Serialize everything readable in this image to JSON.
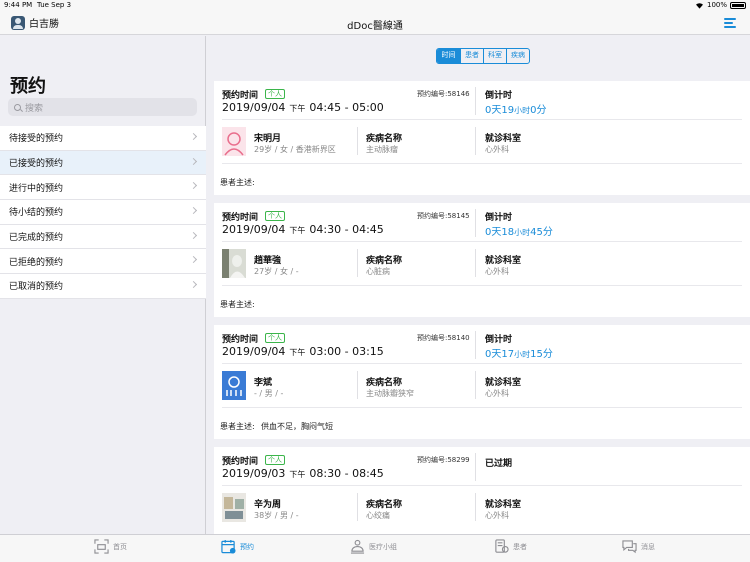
{
  "status": {
    "time": "9:44 PM",
    "date": "Tue Sep 3",
    "battery": "100%"
  },
  "nav": {
    "user_name": "白吉勝",
    "title": "dDoc醫線通"
  },
  "sidebar": {
    "title": "预约",
    "search_placeholder": "搜索",
    "items": [
      {
        "label": "待接受的预约"
      },
      {
        "label": "已接受的预约"
      },
      {
        "label": "进行中的预约"
      },
      {
        "label": "待小结的预约"
      },
      {
        "label": "已完成的预约"
      },
      {
        "label": "已拒绝的预约"
      },
      {
        "label": "已取消的预约"
      }
    ]
  },
  "filter": {
    "options": [
      "时间",
      "患者",
      "科室",
      "疾病"
    ],
    "selected": "时间"
  },
  "cards": [
    {
      "time_label": "预约时间",
      "tag": "个人",
      "order_no": "预约编号:58146",
      "date": "2019/09/04",
      "ampm": "下午",
      "start": "04:45",
      "end": "05:00",
      "countdown_label": "倒计时",
      "cd_d": "0",
      "cd_d_unit": "天",
      "cd_h": "19",
      "cd_h_unit": "小时",
      "cd_m": "0",
      "cd_m_unit": "分",
      "patient": "宋明月",
      "patient_info": "29岁 / 女 / 香港新界区",
      "disease_label": "疾病名称",
      "disease": "主动脉瘤",
      "dept_label": "就诊科室",
      "dept": "心外科",
      "desc_label": "患者主述:",
      "desc": ""
    },
    {
      "time_label": "预约时间",
      "tag": "个人",
      "order_no": "预约编号:58145",
      "date": "2019/09/04",
      "ampm": "下午",
      "start": "04:30",
      "end": "04:45",
      "countdown_label": "倒计时",
      "cd_d": "0",
      "cd_d_unit": "天",
      "cd_h": "18",
      "cd_h_unit": "小时",
      "cd_m": "45",
      "cd_m_unit": "分",
      "patient": "趙華強",
      "patient_info": "27岁 / 女 / -",
      "disease_label": "疾病名称",
      "disease": "心脏病",
      "dept_label": "就诊科室",
      "dept": "心外科",
      "desc_label": "患者主述:",
      "desc": ""
    },
    {
      "time_label": "预约时间",
      "tag": "个人",
      "order_no": "预约编号:58140",
      "date": "2019/09/04",
      "ampm": "下午",
      "start": "03:00",
      "end": "03:15",
      "countdown_label": "倒计时",
      "cd_d": "0",
      "cd_d_unit": "天",
      "cd_h": "17",
      "cd_h_unit": "小时",
      "cd_m": "15",
      "cd_m_unit": "分",
      "patient": "李斌",
      "patient_info": "- / 男 / -",
      "disease_label": "疾病名称",
      "disease": "主动脉瓣狭窄",
      "dept_label": "就诊科室",
      "dept": "心外科",
      "desc_label": "患者主述:",
      "desc": "供血不足，胸闷气短"
    },
    {
      "time_label": "预约时间",
      "tag": "个人",
      "order_no": "预约编号:58299",
      "date": "2019/09/03",
      "ampm": "下午",
      "start": "08:30",
      "end": "08:45",
      "countdown_label": "已过期",
      "patient": "辛为周",
      "patient_info": "38岁 / 男 / -",
      "disease_label": "疾病名称",
      "disease": "心绞痛",
      "dept_label": "就诊科室",
      "dept": "心外科"
    }
  ],
  "tabs": [
    {
      "label": "首页"
    },
    {
      "label": "预约"
    },
    {
      "label": "医疗小组"
    },
    {
      "label": "患者"
    },
    {
      "label": "消息"
    }
  ],
  "colors": {
    "accent": "#1a8cd8",
    "tag_green": "#3bb54a"
  }
}
